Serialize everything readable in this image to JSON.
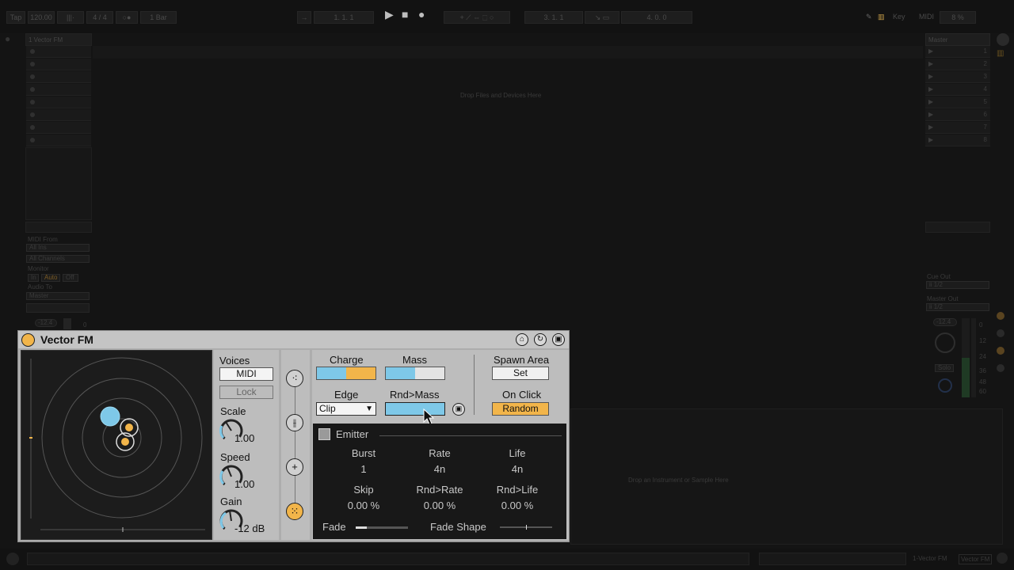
{
  "topbar": {
    "tap": "Tap",
    "tempo": "120.00",
    "signature": "4 / 4",
    "quantize": "1 Bar",
    "position": "1.  1.  1",
    "loop_start": "3.  1.  1",
    "loop_length": "4.  0.  0",
    "key": "Key",
    "midi": "MIDI",
    "cpu": "8 %"
  },
  "session": {
    "track_name": "1 Vector FM",
    "drop_hint": "Drop Files and Devices Here",
    "master_name": "Master",
    "scene_numbers": [
      "1",
      "2",
      "3",
      "4",
      "5",
      "6",
      "7",
      "8"
    ],
    "midi_from_label": "MIDI From",
    "midi_from_value": "All Ins",
    "channels_value": "All Channels",
    "monitor_label": "Monitor",
    "monitor_in": "In",
    "monitor_auto": "Auto",
    "monitor_off": "Off",
    "audio_to_label": "Audio To",
    "audio_to_value": "Master",
    "track_volume": "-12.4",
    "track_zero": "0",
    "cue_out_label": "Cue Out",
    "cue_out_value": "ii 1/2",
    "master_out_label": "Master Out",
    "master_out_value": "ii 1/2",
    "master_volume": "-12.4",
    "solo_label": "Solo",
    "db_scale": [
      "0",
      "12",
      "24",
      "36",
      "48",
      "60"
    ]
  },
  "detail": {
    "drop_instrument": "Drop an Instrument or Sample Here"
  },
  "device": {
    "title": "Vector FM",
    "voices_label": "Voices",
    "voices_mode": "MIDI",
    "lock_label": "Lock",
    "scale_label": "Scale",
    "scale_value": "1.00",
    "scale_level": 0.5,
    "speed_label": "Speed",
    "speed_value": "1.00",
    "speed_level": 0.5,
    "gain_label": "Gain",
    "gain_value": "-12 dB",
    "gain_level": 0.55,
    "charge_label": "Charge",
    "charge_level": 0.5,
    "mass_label": "Mass",
    "mass_level": 0.5,
    "edge_label": "Edge",
    "edge_value": "Clip",
    "rnd_mass_label": "Rnd>Mass",
    "rnd_mass_level": 1.0,
    "spawn_area_label": "Spawn Area",
    "spawn_set_label": "Set",
    "on_click_label": "On Click",
    "on_click_value": "Random",
    "emitter_label": "Emitter",
    "burst_label": "Burst",
    "burst_value": "1",
    "rate_label": "Rate",
    "rate_value": "4n",
    "life_label": "Life",
    "life_value": "4n",
    "skip_label": "Skip",
    "skip_value": "0.00 %",
    "rnd_rate_label": "Rnd>Rate",
    "rnd_rate_value": "0.00 %",
    "rnd_life_label": "Rnd>Life",
    "rnd_life_value": "0.00 %",
    "fade_label": "Fade",
    "fade_shape_label": "Fade Shape",
    "colors": {
      "accent_orange": "#f2b54a",
      "accent_blue": "#7ec8e8",
      "panel": "#adadad"
    }
  },
  "bottombar": {
    "track_tab": "1-Vector FM",
    "device_tab": "Vector FM"
  }
}
